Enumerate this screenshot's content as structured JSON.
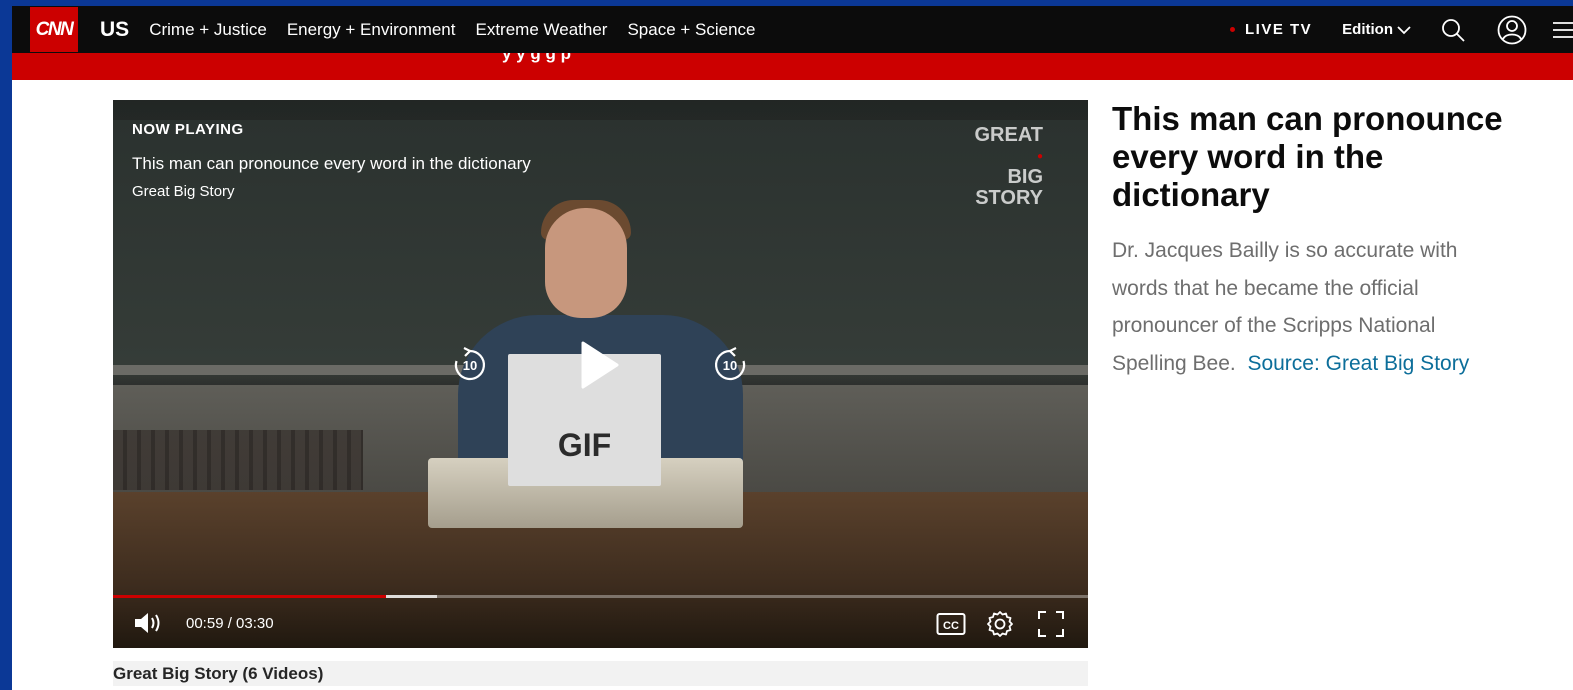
{
  "colors": {
    "outer_background": "#0b3896",
    "brand_red": "#cc0000",
    "nav_background": "#0c0c0c",
    "link_blue": "#0c6e9a"
  },
  "nav": {
    "logo": "CNN",
    "section": "US",
    "links": [
      "Crime + Justice",
      "Energy + Environment",
      "Extreme Weather",
      "Space + Science"
    ],
    "live_tv": "LIVE TV",
    "edition": "Edition",
    "icons": [
      "chevron-down-icon",
      "search-icon",
      "account-icon",
      "menu-icon"
    ]
  },
  "banner": {
    "text": "y  y g  g p"
  },
  "player": {
    "now_playing_label": "NOW PLAYING",
    "title": "This man can pronounce every word in the dictionary",
    "source": "Great Big Story",
    "brand_watermark": [
      "GREAT",
      "BIG",
      "STORY"
    ],
    "card_text": "GIF",
    "rewind_seconds": "10",
    "forward_seconds": "10",
    "time_display": "00:59 / 03:30",
    "progress_fraction": 0.28,
    "buffered_fraction": 0.332,
    "cc_label": "CC",
    "icons": [
      "rewind-10-icon",
      "play-icon",
      "forward-10-icon",
      "volume-icon",
      "cc-icon",
      "settings-icon",
      "fullscreen-icon"
    ]
  },
  "article": {
    "headline": "This man can pronounce every word in the dictionary",
    "description": "Dr. Jacques Bailly is so accurate with words that he became the official pronouncer of the Scripps National Spelling Bee.",
    "source_link": "Source: Great Big Story"
  },
  "playlist": {
    "label": "Great Big Story (6 Videos)"
  }
}
